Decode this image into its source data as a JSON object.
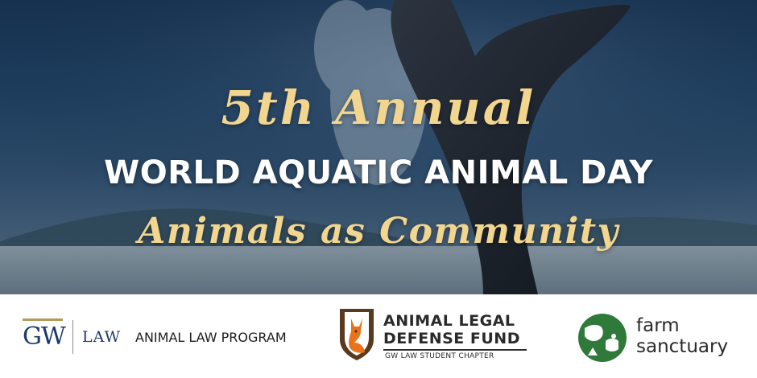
{
  "hero": {
    "edition": "5th Annual",
    "event_name": "WORLD AQUATIC ANIMAL DAY",
    "theme": "Animals as Community",
    "accent_color": "#f2d58f"
  },
  "sponsors": {
    "gw": {
      "letters": "GW",
      "law": "LAW",
      "program": "ANIMAL LAW PROGRAM",
      "color": "#1b3a6b"
    },
    "aldf": {
      "line1": "ANIMAL LEGAL",
      "line2": "DEFENSE FUND",
      "chapter": "GW LAW STUDENT CHAPTER",
      "icon": "fox-shield-icon"
    },
    "farm": {
      "line1": "farm",
      "line2": "sanctuary",
      "icon": "farm-animals-icon",
      "color": "#2f7a3b"
    }
  }
}
